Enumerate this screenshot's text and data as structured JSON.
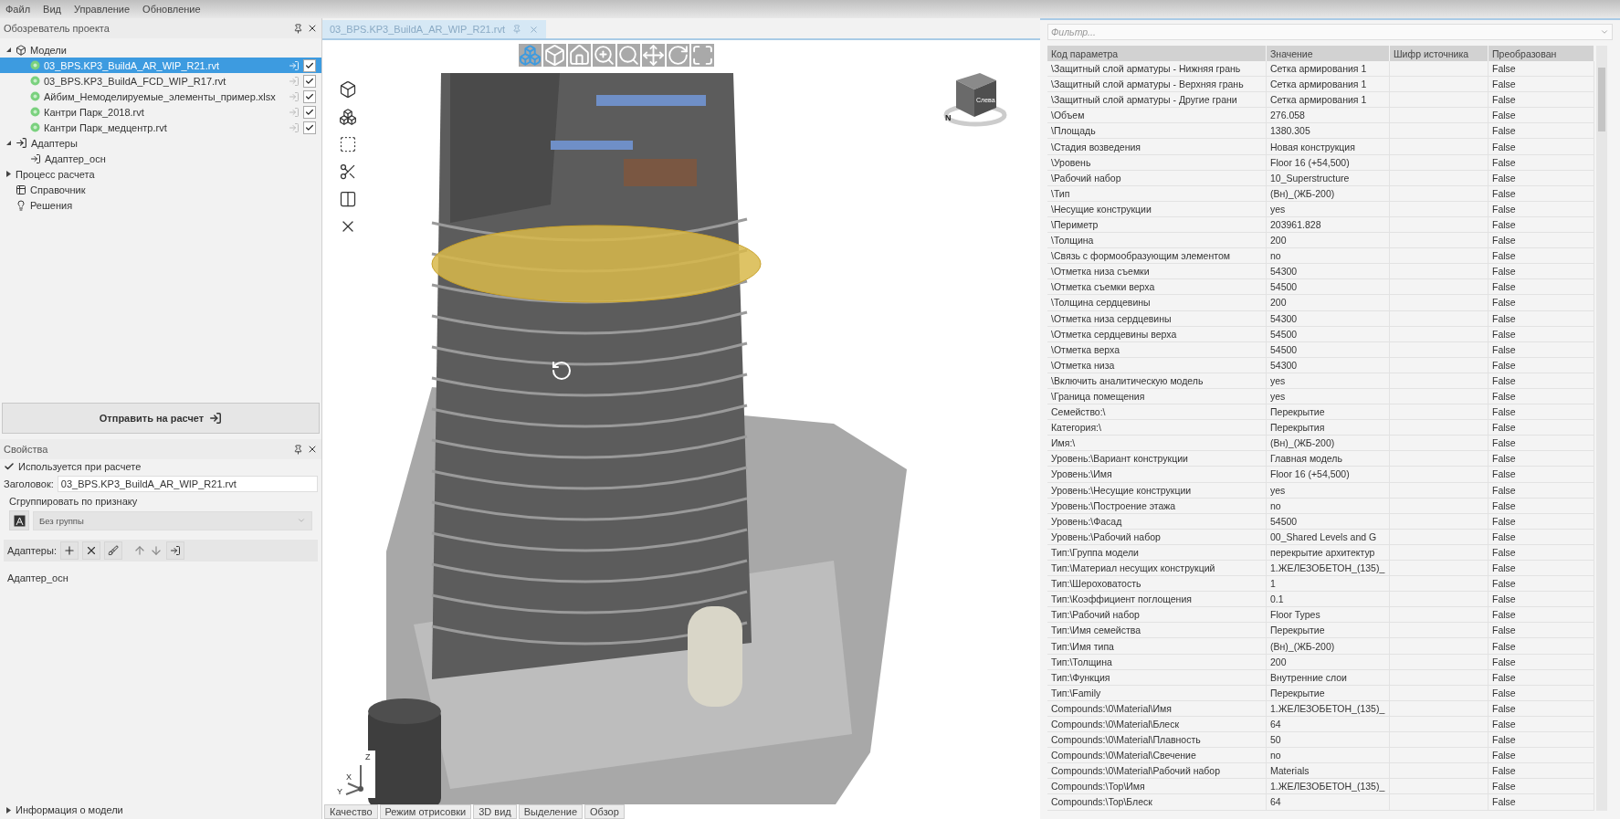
{
  "menu": [
    "Файл",
    "Вид",
    "Управление",
    "Обновление"
  ],
  "project_explorer": {
    "title": "Обозреватель проекта",
    "tree": [
      {
        "kind": "group",
        "label": "Модели",
        "expanded": true,
        "selected": false,
        "children": [
          {
            "kind": "file",
            "label": "03_BPS.KP3_BuildA_AR_WIP_R21.rvt",
            "selected": true,
            "checked": true
          },
          {
            "kind": "file",
            "label": "03_BPS.KP3_BuildA_FCD_WIP_R17.rvt",
            "selected": false,
            "checked": true
          },
          {
            "kind": "file",
            "label": "Айбим_Немоделируемые_элементы_пример.xlsx",
            "selected": false,
            "checked": true
          },
          {
            "kind": "file",
            "label": "Кантри Парк_2018.rvt",
            "selected": false,
            "checked": true
          },
          {
            "kind": "file",
            "label": "Кантри Парк_медцентр.rvt",
            "selected": false,
            "checked": true
          }
        ]
      },
      {
        "kind": "adapters",
        "label": "Адаптеры",
        "expanded": true,
        "selected": false,
        "children": [
          {
            "kind": "adapter",
            "label": "Адаптер_осн",
            "selected": false
          }
        ]
      },
      {
        "kind": "process",
        "label": "Процесс расчета",
        "expanded": false,
        "selected": false
      },
      {
        "kind": "reference",
        "label": "Справочник",
        "selected": false
      },
      {
        "kind": "solutions",
        "label": "Решения",
        "selected": false
      }
    ]
  },
  "send_button": "Отправить на расчет",
  "properties": {
    "title": "Свойства",
    "used_in_calculation": {
      "label": "Используется при расчете",
      "checked": true
    },
    "header_label": "Заголовок:",
    "header_value": "03_BPS.KP3_BuildA_AR_WIP_R21.rvt",
    "group_label": "Сгруппировать по признаку",
    "group_value": "Без группы",
    "adapters_label": "Адаптеры:",
    "adapters": [
      "Адаптер_осн"
    ],
    "footer": {
      "label": "Информация о модели",
      "expanded": false
    }
  },
  "document_tab": {
    "label": "03_BPS.KP3_BuildA_AR_WIP_R21.rvt",
    "selected": true
  },
  "viewport": {
    "view_cube_label": "Слева",
    "compass_label": "N",
    "axis_labels": [
      "Z",
      "X",
      "Y"
    ],
    "bottom_tabs": [
      "Качество",
      "Режим отрисовки",
      "3D вид",
      "Выделение",
      "Обзор"
    ]
  },
  "parameters": {
    "filter_placeholder": "Фильтр...",
    "columns": [
      "Код параметра",
      "Значение",
      "Шифр источника",
      "Преобразован"
    ],
    "rows": [
      {
        "code": "\\Защитный слой арматуры - Нижняя грань",
        "value": "Сетка армирования 1",
        "transformed": "False"
      },
      {
        "code": "\\Защитный слой арматуры - Верхняя грань",
        "value": "Сетка армирования 1",
        "transformed": "False"
      },
      {
        "code": "\\Защитный слой арматуры - Другие грани",
        "value": "Сетка армирования 1",
        "transformed": "False"
      },
      {
        "code": "\\Объем",
        "value": "276.058",
        "transformed": "False"
      },
      {
        "code": "\\Площадь",
        "value": "1380.305",
        "transformed": "False"
      },
      {
        "code": "\\Стадия возведения",
        "value": "Новая конструкция",
        "transformed": "False"
      },
      {
        "code": "\\Уровень",
        "value": "Floor 16 (+54,500)",
        "transformed": "False"
      },
      {
        "code": "\\Рабочий набор",
        "value": "10_Superstructure",
        "transformed": "False"
      },
      {
        "code": "\\Тип",
        "value": "(Вн)_(ЖБ-200)",
        "transformed": "False"
      },
      {
        "code": "\\Несущие конструкции",
        "value": "yes",
        "transformed": "False"
      },
      {
        "code": "\\Периметр",
        "value": "203961.828",
        "transformed": "False"
      },
      {
        "code": "\\Толщина",
        "value": "200",
        "transformed": "False"
      },
      {
        "code": "\\Связь с формообразующим элементом",
        "value": "no",
        "transformed": "False"
      },
      {
        "code": "\\Отметка низа съемки",
        "value": "54300",
        "transformed": "False"
      },
      {
        "code": "\\Отметка съемки верха",
        "value": "54500",
        "transformed": "False"
      },
      {
        "code": "\\Толщина сердцевины",
        "value": "200",
        "transformed": "False"
      },
      {
        "code": "\\Отметка низа сердцевины",
        "value": "54300",
        "transformed": "False"
      },
      {
        "code": "\\Отметка сердцевины верха",
        "value": "54500",
        "transformed": "False"
      },
      {
        "code": "\\Отметка верха",
        "value": "54500",
        "transformed": "False"
      },
      {
        "code": "\\Отметка низа",
        "value": "54300",
        "transformed": "False"
      },
      {
        "code": "\\Включить аналитическую модель",
        "value": "yes",
        "transformed": "False"
      },
      {
        "code": "\\Граница помещения",
        "value": "yes",
        "transformed": "False"
      },
      {
        "code": "Семейство:\\",
        "value": "Перекрытие",
        "transformed": "False"
      },
      {
        "code": "Категория:\\",
        "value": "Перекрытия",
        "transformed": "False"
      },
      {
        "code": "Имя:\\",
        "value": "(Вн)_(ЖБ-200)",
        "transformed": "False"
      },
      {
        "code": "Уровень:\\Вариант конструкции",
        "value": "Главная модель",
        "transformed": "False"
      },
      {
        "code": "Уровень:\\Имя",
        "value": "Floor 16 (+54,500)",
        "transformed": "False"
      },
      {
        "code": "Уровень:\\Несущие конструкции",
        "value": "yes",
        "transformed": "False"
      },
      {
        "code": "Уровень:\\Построение этажа",
        "value": "no",
        "transformed": "False"
      },
      {
        "code": "Уровень:\\Фасад",
        "value": "54500",
        "transformed": "False"
      },
      {
        "code": "Уровень:\\Рабочий набор",
        "value": "00_Shared Levels and G",
        "transformed": "False"
      },
      {
        "code": "Тип:\\Группа модели",
        "value": "перекрытие архитектур",
        "transformed": "False"
      },
      {
        "code": "Тип:\\Материал несущих конструкций",
        "value": "1.ЖЕЛЕЗОБЕТОН_(135)_",
        "transformed": "False"
      },
      {
        "code": "Тип:\\Шероховатость",
        "value": "1",
        "transformed": "False"
      },
      {
        "code": "Тип:\\Коэффициент поглощения",
        "value": "0.1",
        "transformed": "False"
      },
      {
        "code": "Тип:\\Рабочий набор",
        "value": "Floor Types",
        "transformed": "False"
      },
      {
        "code": "Тип:\\Имя семейства",
        "value": "Перекрытие",
        "transformed": "False"
      },
      {
        "code": "Тип:\\Имя типа",
        "value": "(Вн)_(ЖБ-200)",
        "transformed": "False"
      },
      {
        "code": "Тип:\\Толщина",
        "value": "200",
        "transformed": "False"
      },
      {
        "code": "Тип:\\Функция",
        "value": "Внутренние слои",
        "transformed": "False"
      },
      {
        "code": "Тип:\\Family",
        "value": "Перекрытие",
        "transformed": "False"
      },
      {
        "code": "Compounds:\\0\\Material\\Имя",
        "value": "1.ЖЕЛЕЗОБЕТОН_(135)_",
        "transformed": "False"
      },
      {
        "code": "Compounds:\\0\\Material\\Блеск",
        "value": "64",
        "transformed": "False"
      },
      {
        "code": "Compounds:\\0\\Material\\Плавность",
        "value": "50",
        "transformed": "False"
      },
      {
        "code": "Compounds:\\0\\Material\\Свечение",
        "value": "no",
        "transformed": "False"
      },
      {
        "code": "Compounds:\\0\\Material\\Рабочий набор",
        "value": "Materials",
        "transformed": "False"
      },
      {
        "code": "Compounds:\\Top\\Имя",
        "value": "1.ЖЕЛЕЗОБЕТОН_(135)_",
        "transformed": "False"
      },
      {
        "code": "Compounds:\\Top\\Блеск",
        "value": "64",
        "transformed": "False"
      }
    ]
  }
}
